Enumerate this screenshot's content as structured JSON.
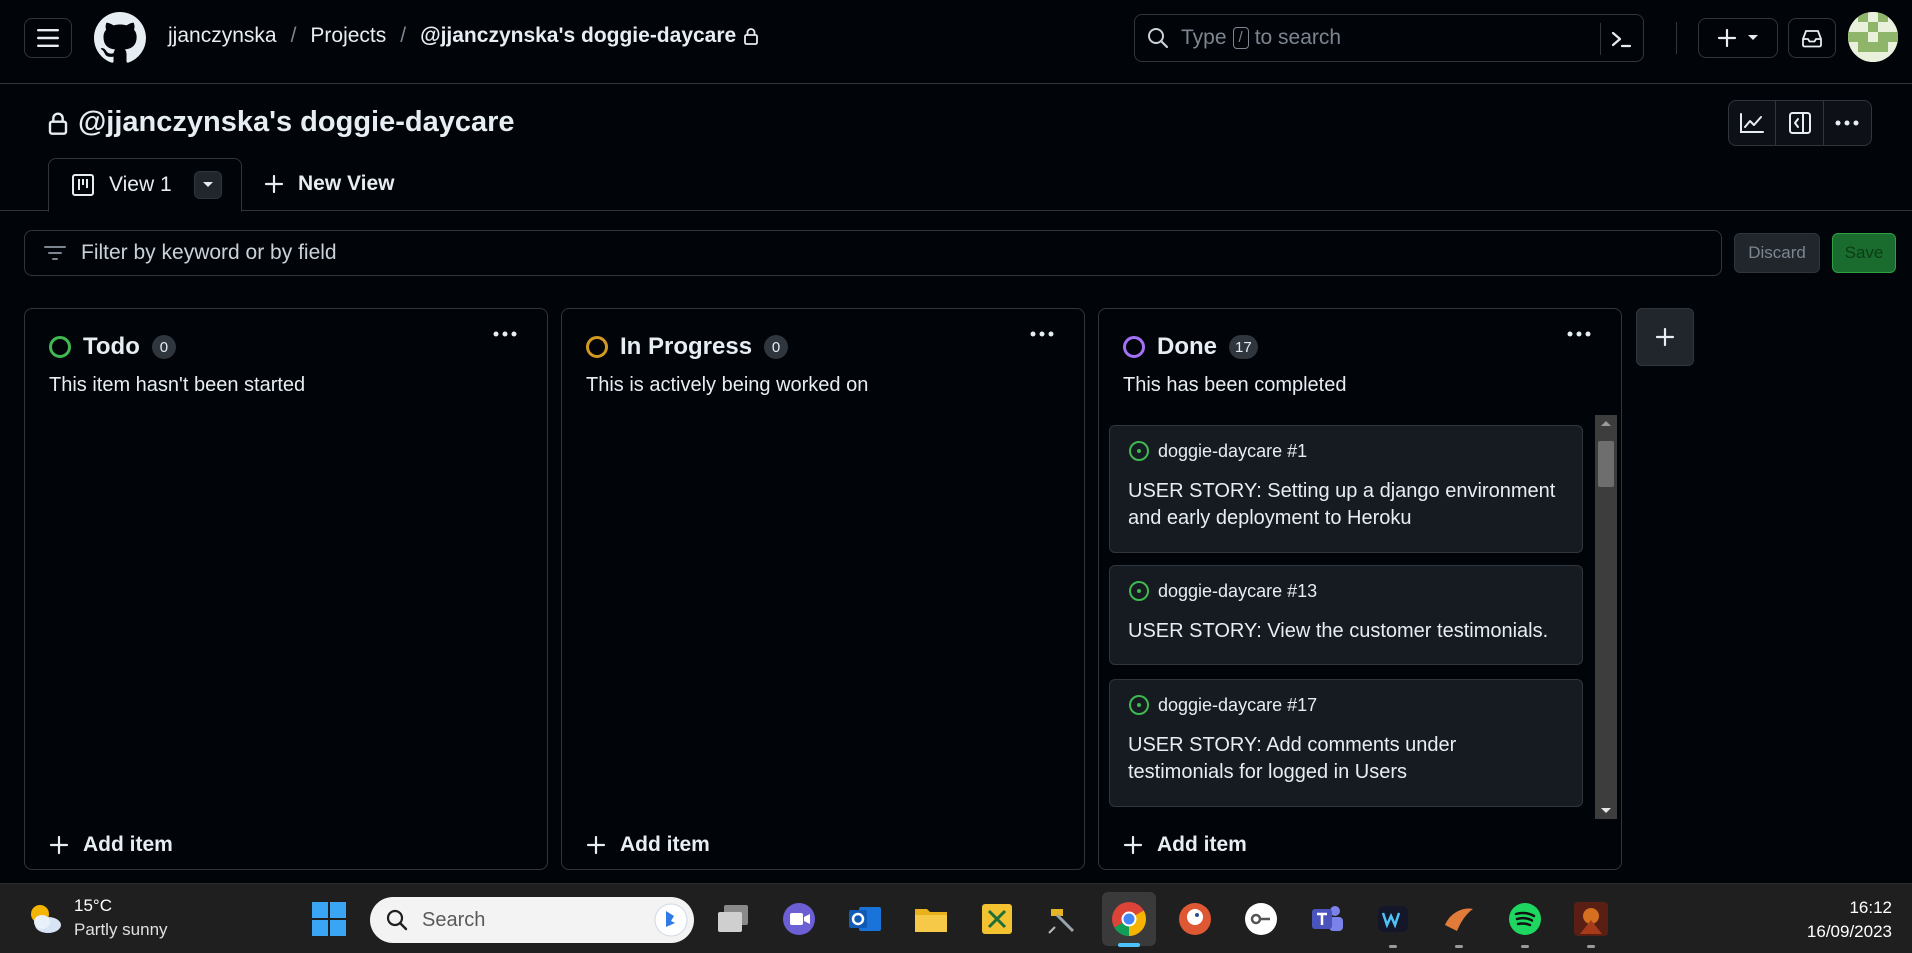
{
  "header": {
    "breadcrumb": [
      "jjanczynska",
      "Projects",
      "@jjanczynska's doggie-daycare"
    ],
    "search_prefix": "Type",
    "search_key": "/",
    "search_suffix": "to search"
  },
  "project": {
    "title": "@jjanczynska's doggie-daycare"
  },
  "tabs": {
    "view1": "View 1",
    "new_view": "New View"
  },
  "filter": {
    "placeholder": "Filter by keyword or by field",
    "discard": "Discard",
    "save": "Save"
  },
  "columns": [
    {
      "title": "Todo",
      "count": "0",
      "description": "This item hasn't been started",
      "color": "#3fb950",
      "add_label": "Add item"
    },
    {
      "title": "In Progress",
      "count": "0",
      "description": "This is actively being worked on",
      "color": "#d29922",
      "add_label": "Add item"
    },
    {
      "title": "Done",
      "count": "17",
      "description": "This has been completed",
      "color": "#a371f7",
      "add_label": "Add item",
      "cards": [
        {
          "ref": "doggie-daycare #1",
          "title": "USER STORY: Setting up a django environment and early deployment to Heroku"
        },
        {
          "ref": "doggie-daycare #13",
          "title": "USER STORY: View the customer testimonials."
        },
        {
          "ref": "doggie-daycare #17",
          "title": "USER STORY: Add comments under testimonials for logged in Users"
        }
      ]
    }
  ],
  "taskbar": {
    "temperature": "15°C",
    "condition": "Partly sunny",
    "search": "Search",
    "time": "16:12",
    "date": "16/09/2023"
  },
  "colors": {
    "background": "#010409",
    "border": "#30363d",
    "open_issue": "#3fb950",
    "save_green": "#196c2e"
  }
}
